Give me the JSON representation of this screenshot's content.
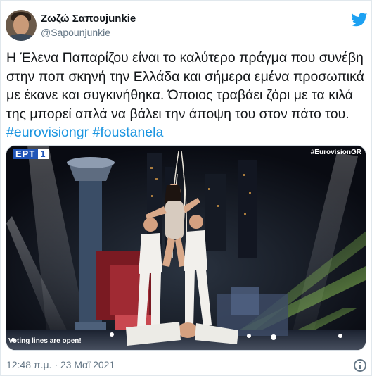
{
  "author": {
    "display_name": "Ζωζώ Σαπουjunkie",
    "handle": "@Sapounjunkie"
  },
  "tweet": {
    "body": "Η Έλενα Παπαρίζου είναι το καλύτερο πράγμα που συνέβη στην ποπ σκηνή την Ελλάδα και σήμερα εμένα προσωπικά με έκανε και συγκινήθηκα. Όποιος τραβάει ζόρι με τα κιλά της μπορεί απλά να βάλει την άποψη του στον πάτο του.",
    "hashtags": [
      "#eurovisiongr",
      "#foustanela"
    ],
    "timestamp": "12:48 π.μ. · 23 Μαΐ 2021"
  },
  "media": {
    "broadcaster_logo": "ΕΡΤ",
    "broadcaster_channel": "1",
    "channel_tag": "#EurovisionGR",
    "ticker": "Voting lines are open!"
  },
  "icons": {
    "brand": "twitter-bird-icon",
    "info": "info-icon"
  },
  "colors": {
    "hashtag": "#1b95e0",
    "twitter_blue": "#1da1f2",
    "secondary_text": "#657786"
  }
}
